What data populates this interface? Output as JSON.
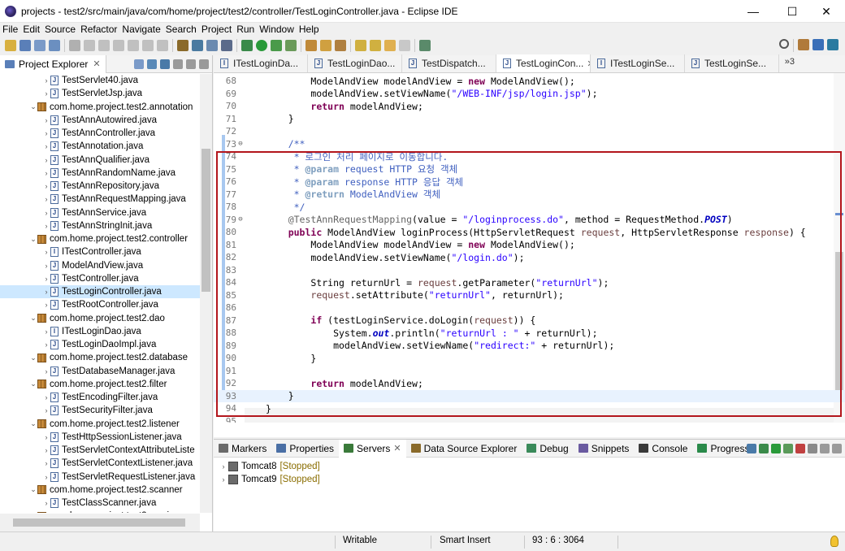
{
  "window": {
    "title": "projects - test2/src/main/java/com/home/project/test2/controller/TestLoginController.java - Eclipse IDE",
    "minimize_glyph": "—",
    "maximize_glyph": "☐",
    "close_glyph": "✕"
  },
  "menu": [
    "File",
    "Edit",
    "Source",
    "Refactor",
    "Navigate",
    "Search",
    "Project",
    "Run",
    "Window",
    "Help"
  ],
  "explorer": {
    "tab_label": "Project Explorer",
    "close_glyph": "✕",
    "items": [
      {
        "type": "file",
        "label": "TestServlet40.java",
        "indent": 2
      },
      {
        "type": "file",
        "label": "TestServletJsp.java",
        "indent": 2
      },
      {
        "type": "pkg",
        "label": "com.home.project.test2.annotation",
        "indent": 1
      },
      {
        "type": "file",
        "label": "TestAnnAutowired.java",
        "indent": 2
      },
      {
        "type": "file",
        "label": "TestAnnController.java",
        "indent": 2
      },
      {
        "type": "file",
        "label": "TestAnnotation.java",
        "indent": 2
      },
      {
        "type": "file",
        "label": "TestAnnQualifier.java",
        "indent": 2
      },
      {
        "type": "file",
        "label": "TestAnnRandomName.java",
        "indent": 2
      },
      {
        "type": "file",
        "label": "TestAnnRepository.java",
        "indent": 2
      },
      {
        "type": "file",
        "label": "TestAnnRequestMapping.java",
        "indent": 2
      },
      {
        "type": "file",
        "label": "TestAnnService.java",
        "indent": 2
      },
      {
        "type": "file",
        "label": "TestAnnStringInit.java",
        "indent": 2
      },
      {
        "type": "pkg",
        "label": "com.home.project.test2.controller",
        "indent": 1
      },
      {
        "type": "file",
        "label": "ITestController.java",
        "indent": 2,
        "interface": true
      },
      {
        "type": "file",
        "label": "ModelAndView.java",
        "indent": 2
      },
      {
        "type": "file",
        "label": "TestController.java",
        "indent": 2
      },
      {
        "type": "file",
        "label": "TestLoginController.java",
        "indent": 2,
        "selected": true
      },
      {
        "type": "file",
        "label": "TestRootController.java",
        "indent": 2
      },
      {
        "type": "pkg",
        "label": "com.home.project.test2.dao",
        "indent": 1
      },
      {
        "type": "file",
        "label": "ITestLoginDao.java",
        "indent": 2,
        "interface": true
      },
      {
        "type": "file",
        "label": "TestLoginDaoImpl.java",
        "indent": 2
      },
      {
        "type": "pkg",
        "label": "com.home.project.test2.database",
        "indent": 1
      },
      {
        "type": "file",
        "label": "TestDatabaseManager.java",
        "indent": 2
      },
      {
        "type": "pkg",
        "label": "com.home.project.test2.filter",
        "indent": 1
      },
      {
        "type": "file",
        "label": "TestEncodingFilter.java",
        "indent": 2
      },
      {
        "type": "file",
        "label": "TestSecurityFilter.java",
        "indent": 2
      },
      {
        "type": "pkg",
        "label": "com.home.project.test2.listener",
        "indent": 1
      },
      {
        "type": "file",
        "label": "TestHttpSessionListener.java",
        "indent": 2
      },
      {
        "type": "file",
        "label": "TestServletContextAttributeListe",
        "indent": 2
      },
      {
        "type": "file",
        "label": "TestServletContextListener.java",
        "indent": 2
      },
      {
        "type": "file",
        "label": "TestServletRequestListener.java",
        "indent": 2
      },
      {
        "type": "pkg",
        "label": "com.home.project.test2.scanner",
        "indent": 1
      },
      {
        "type": "file",
        "label": "TestClassScanner.java",
        "indent": 2
      },
      {
        "type": "pkg",
        "label": "com.home.project.test2.service",
        "indent": 1
      }
    ]
  },
  "editor": {
    "tabs": [
      {
        "label": "ITestLoginDa...",
        "interface": true,
        "active": false
      },
      {
        "label": "TestLoginDao...",
        "active": false
      },
      {
        "label": "TestDispatch...",
        "active": false
      },
      {
        "label": "TestLoginCon...",
        "active": true
      },
      {
        "label": "ITestLoginSe...",
        "interface": true,
        "active": false
      },
      {
        "label": "TestLoginSe...",
        "active": false
      }
    ],
    "more_tabs": "»3",
    "close_glyph": "✕",
    "lines": [
      {
        "n": "68",
        "html": "        ModelAndView modelAndView = <span class=\"kw\">new</span> ModelAndView();"
      },
      {
        "n": "69",
        "html": "        modelAndView.setViewName(<span class=\"str\">\"/WEB-INF/jsp/login.jsp\"</span>);"
      },
      {
        "n": "70",
        "html": "        <span class=\"kw\">return</span> modelAndView;"
      },
      {
        "n": "71",
        "html": "    }"
      },
      {
        "n": "72",
        "html": ""
      },
      {
        "n": "73",
        "fold": "⊖",
        "html": "    <span class=\"cm\">/**</span>"
      },
      {
        "n": "74",
        "html": "<span class=\"cm\">     * 로그인 처리 페이지로 이동합니다.</span>"
      },
      {
        "n": "75",
        "html": "<span class=\"cm\">     * <span class=\"cmtag\">@param</span> request HTTP 요청 객체</span>"
      },
      {
        "n": "76",
        "html": "<span class=\"cm\">     * <span class=\"cmtag\">@param</span> response HTTP 응답 객체</span>"
      },
      {
        "n": "77",
        "html": "<span class=\"cm\">     * <span class=\"cmtag\">@return</span> ModelAndView 객체</span>"
      },
      {
        "n": "78",
        "html": "<span class=\"cm\">     */</span>"
      },
      {
        "n": "79",
        "fold": "⊖",
        "html": "    <span class=\"ann\">@TestAnnRequestMapping</span>(value = <span class=\"str\">\"/loginprocess.do\"</span>, method = RequestMethod.<span class=\"field\">POST</span>)"
      },
      {
        "n": "80",
        "html": "    <span class=\"kw\">public</span> ModelAndView loginProcess(HttpServletRequest <span class=\"param\">request</span>, HttpServletResponse <span class=\"param\">response</span>) {"
      },
      {
        "n": "81",
        "html": "        ModelAndView modelAndView = <span class=\"kw\">new</span> ModelAndView();"
      },
      {
        "n": "82",
        "html": "        modelAndView.setViewName(<span class=\"str\">\"/login.do\"</span>);"
      },
      {
        "n": "83",
        "html": ""
      },
      {
        "n": "84",
        "html": "        String returnUrl = <span class=\"param\">request</span>.getParameter(<span class=\"str\">\"returnUrl\"</span>);"
      },
      {
        "n": "85",
        "html": "        <span class=\"param\">request</span>.setAttribute(<span class=\"str\">\"returnUrl\"</span>, returnUrl);"
      },
      {
        "n": "86",
        "html": ""
      },
      {
        "n": "87",
        "html": "        <span class=\"kw\">if</span> (testLoginService.doLogin(<span class=\"param\">request</span>)) {"
      },
      {
        "n": "88",
        "html": "            System.<span class=\"field\">out</span>.println(<span class=\"str\">\"returnUrl : \"</span> + returnUrl);"
      },
      {
        "n": "89",
        "html": "            modelAndView.setViewName(<span class=\"str\">\"redirect:\"</span> + returnUrl);"
      },
      {
        "n": "90",
        "html": "        }"
      },
      {
        "n": "91",
        "html": ""
      },
      {
        "n": "92",
        "html": "        <span class=\"kw\">return</span> modelAndView;"
      },
      {
        "n": "93",
        "current": true,
        "html": "    }"
      },
      {
        "n": "94",
        "html": "}"
      },
      {
        "n": "95",
        "html": ""
      }
    ]
  },
  "bottom": {
    "tabs": [
      {
        "label": "Markers",
        "color": "#6a6a6a"
      },
      {
        "label": "Properties",
        "color": "#4a6fa5"
      },
      {
        "label": "Servers",
        "color": "#3a7a3a",
        "active": true
      },
      {
        "label": "Data Source Explorer",
        "color": "#8a6a2a"
      },
      {
        "label": "Debug",
        "color": "#3a8a5a"
      },
      {
        "label": "Snippets",
        "color": "#6a5aa0"
      },
      {
        "label": "Console",
        "color": "#3a3a3a"
      },
      {
        "label": "Progress",
        "color": "#2a8a4a"
      }
    ],
    "close_glyph": "✕",
    "servers": [
      {
        "name": "Tomcat8",
        "status": "[Stopped]"
      },
      {
        "name": "Tomcat9",
        "status": "[Stopped]"
      }
    ]
  },
  "status": {
    "writable": "Writable",
    "insert_mode": "Smart Insert",
    "position": "93 : 6 : 3064"
  }
}
